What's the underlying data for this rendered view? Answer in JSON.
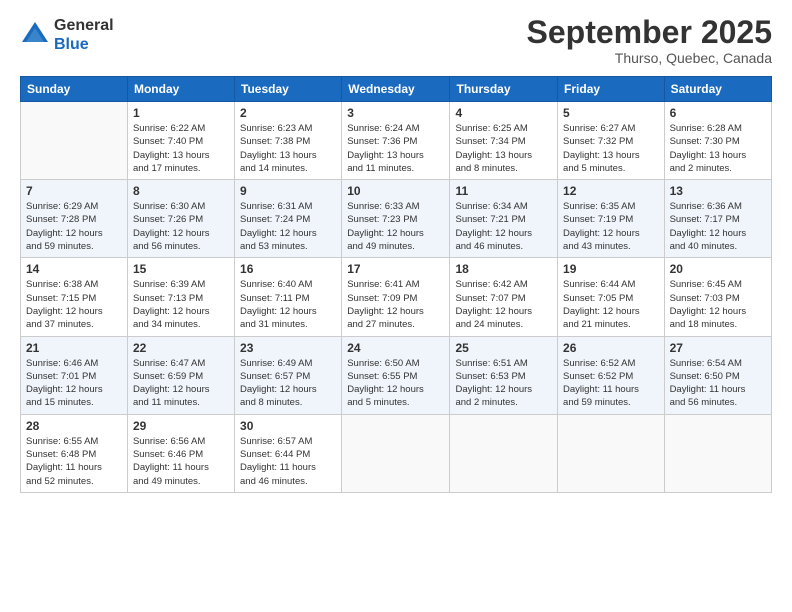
{
  "header": {
    "logo_general": "General",
    "logo_blue": "Blue",
    "month_title": "September 2025",
    "location": "Thurso, Quebec, Canada"
  },
  "weekdays": [
    "Sunday",
    "Monday",
    "Tuesday",
    "Wednesday",
    "Thursday",
    "Friday",
    "Saturday"
  ],
  "weeks": [
    [
      {
        "day": "",
        "info": ""
      },
      {
        "day": "1",
        "info": "Sunrise: 6:22 AM\nSunset: 7:40 PM\nDaylight: 13 hours\nand 17 minutes."
      },
      {
        "day": "2",
        "info": "Sunrise: 6:23 AM\nSunset: 7:38 PM\nDaylight: 13 hours\nand 14 minutes."
      },
      {
        "day": "3",
        "info": "Sunrise: 6:24 AM\nSunset: 7:36 PM\nDaylight: 13 hours\nand 11 minutes."
      },
      {
        "day": "4",
        "info": "Sunrise: 6:25 AM\nSunset: 7:34 PM\nDaylight: 13 hours\nand 8 minutes."
      },
      {
        "day": "5",
        "info": "Sunrise: 6:27 AM\nSunset: 7:32 PM\nDaylight: 13 hours\nand 5 minutes."
      },
      {
        "day": "6",
        "info": "Sunrise: 6:28 AM\nSunset: 7:30 PM\nDaylight: 13 hours\nand 2 minutes."
      }
    ],
    [
      {
        "day": "7",
        "info": "Sunrise: 6:29 AM\nSunset: 7:28 PM\nDaylight: 12 hours\nand 59 minutes."
      },
      {
        "day": "8",
        "info": "Sunrise: 6:30 AM\nSunset: 7:26 PM\nDaylight: 12 hours\nand 56 minutes."
      },
      {
        "day": "9",
        "info": "Sunrise: 6:31 AM\nSunset: 7:24 PM\nDaylight: 12 hours\nand 53 minutes."
      },
      {
        "day": "10",
        "info": "Sunrise: 6:33 AM\nSunset: 7:23 PM\nDaylight: 12 hours\nand 49 minutes."
      },
      {
        "day": "11",
        "info": "Sunrise: 6:34 AM\nSunset: 7:21 PM\nDaylight: 12 hours\nand 46 minutes."
      },
      {
        "day": "12",
        "info": "Sunrise: 6:35 AM\nSunset: 7:19 PM\nDaylight: 12 hours\nand 43 minutes."
      },
      {
        "day": "13",
        "info": "Sunrise: 6:36 AM\nSunset: 7:17 PM\nDaylight: 12 hours\nand 40 minutes."
      }
    ],
    [
      {
        "day": "14",
        "info": "Sunrise: 6:38 AM\nSunset: 7:15 PM\nDaylight: 12 hours\nand 37 minutes."
      },
      {
        "day": "15",
        "info": "Sunrise: 6:39 AM\nSunset: 7:13 PM\nDaylight: 12 hours\nand 34 minutes."
      },
      {
        "day": "16",
        "info": "Sunrise: 6:40 AM\nSunset: 7:11 PM\nDaylight: 12 hours\nand 31 minutes."
      },
      {
        "day": "17",
        "info": "Sunrise: 6:41 AM\nSunset: 7:09 PM\nDaylight: 12 hours\nand 27 minutes."
      },
      {
        "day": "18",
        "info": "Sunrise: 6:42 AM\nSunset: 7:07 PM\nDaylight: 12 hours\nand 24 minutes."
      },
      {
        "day": "19",
        "info": "Sunrise: 6:44 AM\nSunset: 7:05 PM\nDaylight: 12 hours\nand 21 minutes."
      },
      {
        "day": "20",
        "info": "Sunrise: 6:45 AM\nSunset: 7:03 PM\nDaylight: 12 hours\nand 18 minutes."
      }
    ],
    [
      {
        "day": "21",
        "info": "Sunrise: 6:46 AM\nSunset: 7:01 PM\nDaylight: 12 hours\nand 15 minutes."
      },
      {
        "day": "22",
        "info": "Sunrise: 6:47 AM\nSunset: 6:59 PM\nDaylight: 12 hours\nand 11 minutes."
      },
      {
        "day": "23",
        "info": "Sunrise: 6:49 AM\nSunset: 6:57 PM\nDaylight: 12 hours\nand 8 minutes."
      },
      {
        "day": "24",
        "info": "Sunrise: 6:50 AM\nSunset: 6:55 PM\nDaylight: 12 hours\nand 5 minutes."
      },
      {
        "day": "25",
        "info": "Sunrise: 6:51 AM\nSunset: 6:53 PM\nDaylight: 12 hours\nand 2 minutes."
      },
      {
        "day": "26",
        "info": "Sunrise: 6:52 AM\nSunset: 6:52 PM\nDaylight: 11 hours\nand 59 minutes."
      },
      {
        "day": "27",
        "info": "Sunrise: 6:54 AM\nSunset: 6:50 PM\nDaylight: 11 hours\nand 56 minutes."
      }
    ],
    [
      {
        "day": "28",
        "info": "Sunrise: 6:55 AM\nSunset: 6:48 PM\nDaylight: 11 hours\nand 52 minutes."
      },
      {
        "day": "29",
        "info": "Sunrise: 6:56 AM\nSunset: 6:46 PM\nDaylight: 11 hours\nand 49 minutes."
      },
      {
        "day": "30",
        "info": "Sunrise: 6:57 AM\nSunset: 6:44 PM\nDaylight: 11 hours\nand 46 minutes."
      },
      {
        "day": "",
        "info": ""
      },
      {
        "day": "",
        "info": ""
      },
      {
        "day": "",
        "info": ""
      },
      {
        "day": "",
        "info": ""
      }
    ]
  ]
}
